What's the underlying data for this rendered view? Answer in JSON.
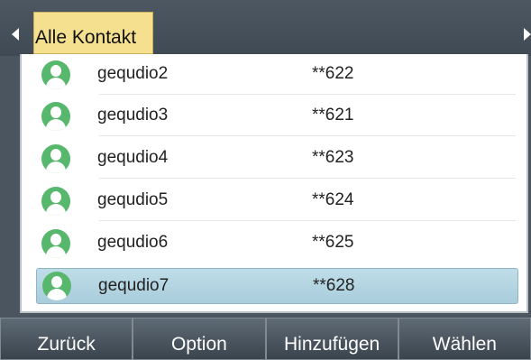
{
  "header": {
    "active_tab": "Alle Kontakt"
  },
  "contacts": [
    {
      "name": "gequdio2",
      "number": "**622"
    },
    {
      "name": "gequdio3",
      "number": "**621"
    },
    {
      "name": "gequdio4",
      "number": "**623"
    },
    {
      "name": "gequdio5",
      "number": "**624"
    },
    {
      "name": "gequdio6",
      "number": "**625"
    },
    {
      "name": "gequdio7",
      "number": "**628"
    }
  ],
  "selected_index": 5,
  "softkeys": {
    "back": "Zurück",
    "option": "Option",
    "add": "Hinzufügen",
    "select": "Wählen"
  },
  "icons": {
    "contact": "contact-avatar-icon",
    "left": "arrow-left-icon",
    "right": "arrow-right-icon"
  },
  "colors": {
    "tab_highlight": "#f5e08f",
    "selection": "#b5d6e3",
    "avatar": "#57b86d"
  }
}
